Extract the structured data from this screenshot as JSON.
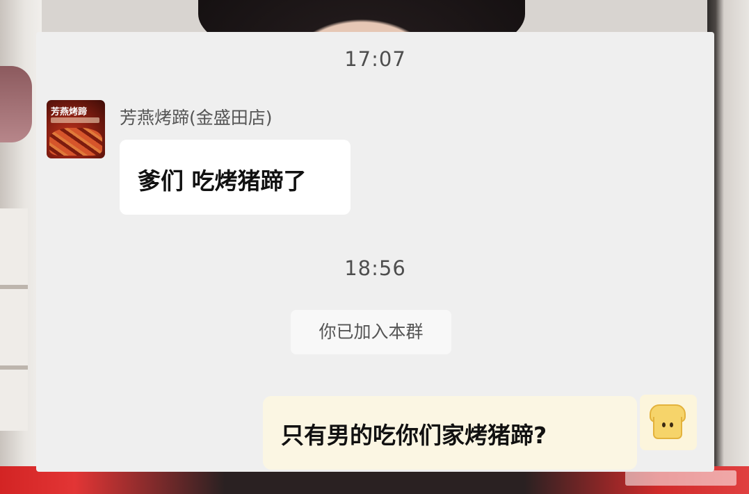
{
  "chat": {
    "timestamp_1": "17:07",
    "sender_name": "芳燕烤蹄(金盛田店)",
    "incoming_message": "爹们 吃烤猪蹄了",
    "avatar_text": "芳燕烤蹄",
    "timestamp_2": "18:56",
    "system_note": "你已加入本群",
    "outgoing_message": "只有男的吃你们家烤猪蹄?"
  },
  "icons": {
    "sender_avatar": "food-photo-avatar",
    "my_avatar": "toast-face-avatar"
  },
  "colors": {
    "card_bg": "#efefef",
    "incoming_bubble": "#ffffff",
    "outgoing_bubble": "#fbf6e3",
    "timestamp_text": "#4e4e4e"
  }
}
